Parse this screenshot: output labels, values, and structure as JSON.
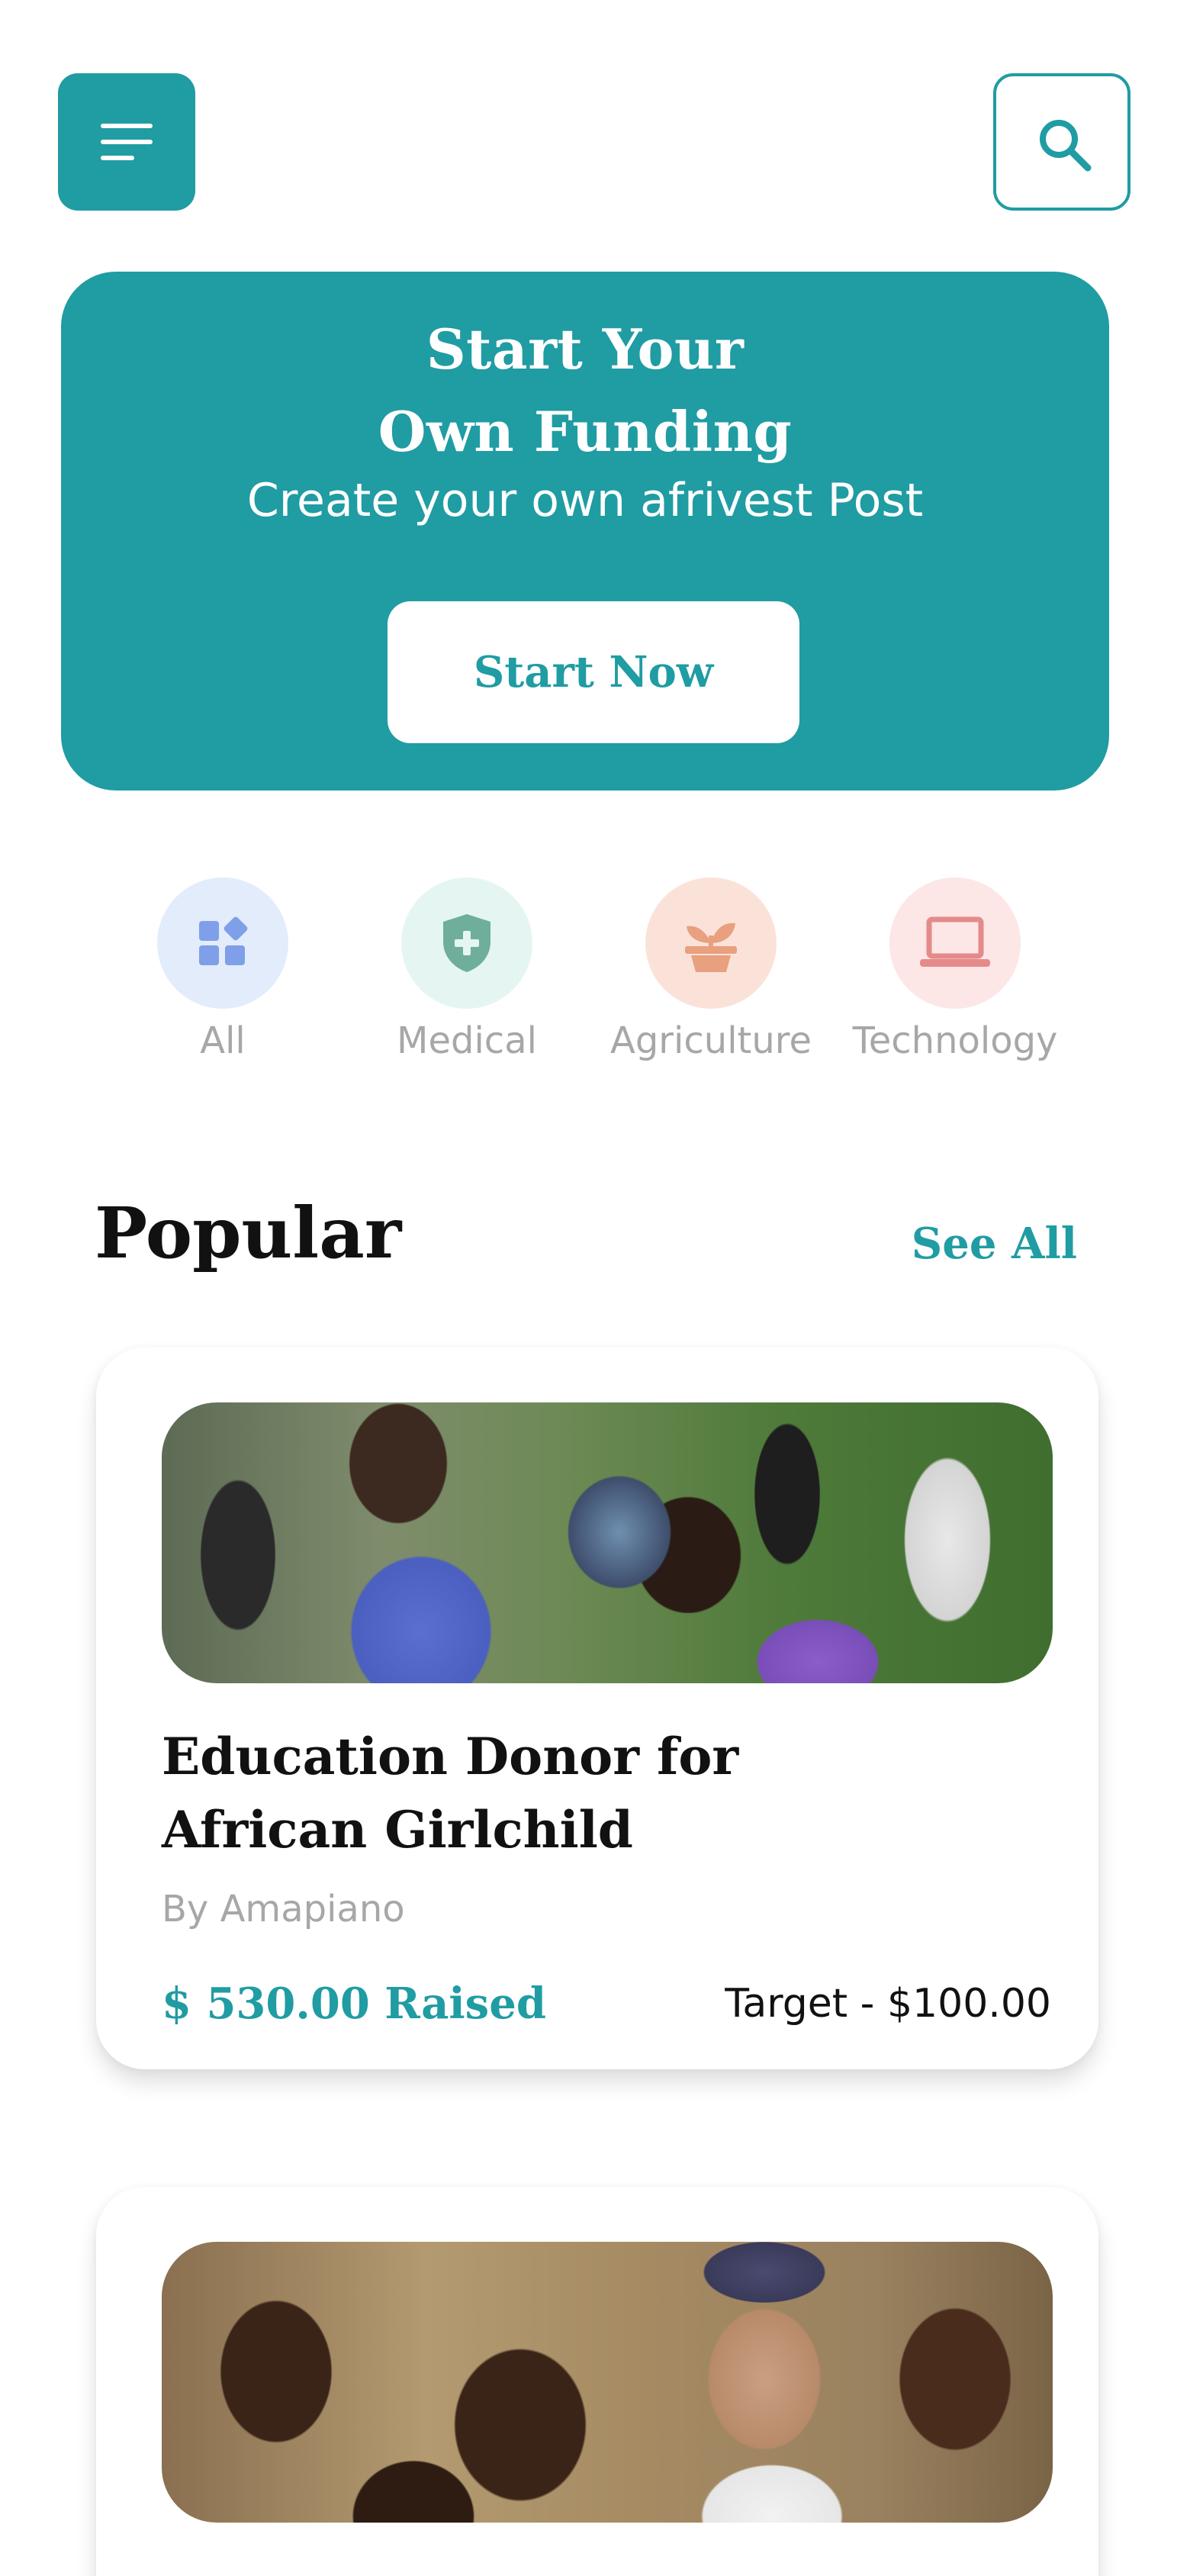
{
  "header": {
    "menu_icon": "hamburger-menu-icon",
    "search_icon": "search-icon"
  },
  "banner": {
    "title_line1": "Start Your",
    "title_line2": "Own Funding",
    "subtitle": "Create your own afrivest Post",
    "button_label": "Start Now"
  },
  "categories": [
    {
      "label": "All",
      "icon": "grid-icon",
      "bg": "#E3ECFB",
      "color": "#7F9FE8"
    },
    {
      "label": "Medical",
      "icon": "shield-plus-icon",
      "bg": "#E5F6F2",
      "color": "#6FAE9B"
    },
    {
      "label": "Agriculture",
      "icon": "plant-icon",
      "bg": "#FBE2D8",
      "color": "#E8A07E"
    },
    {
      "label": "Technology",
      "icon": "laptop-icon",
      "bg": "#FCE6E6",
      "color": "#E58A8A"
    }
  ],
  "popular": {
    "title": "Popular",
    "see_all": "See All",
    "cards": [
      {
        "title_line1": "Education Donor for",
        "title_line2": "African Girlchild",
        "author": "By Amapiano",
        "raised": "$ 530.00 Raised",
        "target": "Target - $100.00"
      }
    ]
  },
  "colors": {
    "accent": "#209CA3",
    "muted_text": "#A7A7A7",
    "dark_text": "#111111"
  }
}
